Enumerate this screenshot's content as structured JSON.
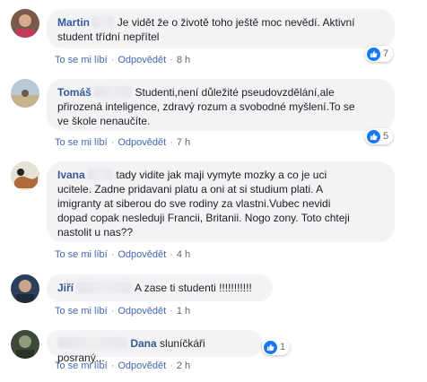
{
  "comments": [
    {
      "author": "Martin",
      "text_line1": "Je vidět že o životě toho ještě moc nevědí. Aktivní",
      "text_line2": "student třídní nepřítel",
      "like": "To se mi líbí",
      "reply": "Odpovědět",
      "time": "8 h",
      "reactions": "7"
    },
    {
      "author": "Tomáš",
      "text_line1": "Studenti,není důležité pseudovzdělání,ale",
      "text_line2": "přirozená inteligence, zdravý rozum a svobodné myšlení.To se",
      "text_line3": "ve škole nenaučíte.",
      "like": "To se mi líbí",
      "reply": "Odpovědět",
      "time": "7 h",
      "reactions": "5"
    },
    {
      "author": "Ivana",
      "text_line1": "tady vidite jak maji vymyte mozky a co je uci",
      "text_line2": "ucitele. Zadne pridavani platu a oni at si studium plati. A",
      "text_line3": "imigranty at siberou do sve rodiny za vlastni.Vubec nevidi",
      "text_line4": "dopad copak nesleduji Francii, Britanii. Nogo zony. Toto chteji",
      "text_line5": "nastolit u nas??",
      "like": "To se mi líbí",
      "reply": "Odpovědět",
      "time": "4 h"
    },
    {
      "author": "Jiří",
      "text_line1": "A zase ti studenti !!!!!!!!!!!",
      "like": "To se mi líbí",
      "reply": "Odpovědět",
      "time": "1 h"
    },
    {
      "author": "Dana",
      "text_line1": "sluníčkáři posraný...",
      "like": "To se mi líbí",
      "reply": "Odpovědět",
      "time": "2 h",
      "reactions": "1"
    }
  ],
  "icons": {
    "like_reaction": "thumbs-up-icon"
  },
  "colors": {
    "author": "#385898",
    "link": "#4267b2",
    "bubble": "#f2f3f5",
    "like_badge": "#1877f2"
  }
}
